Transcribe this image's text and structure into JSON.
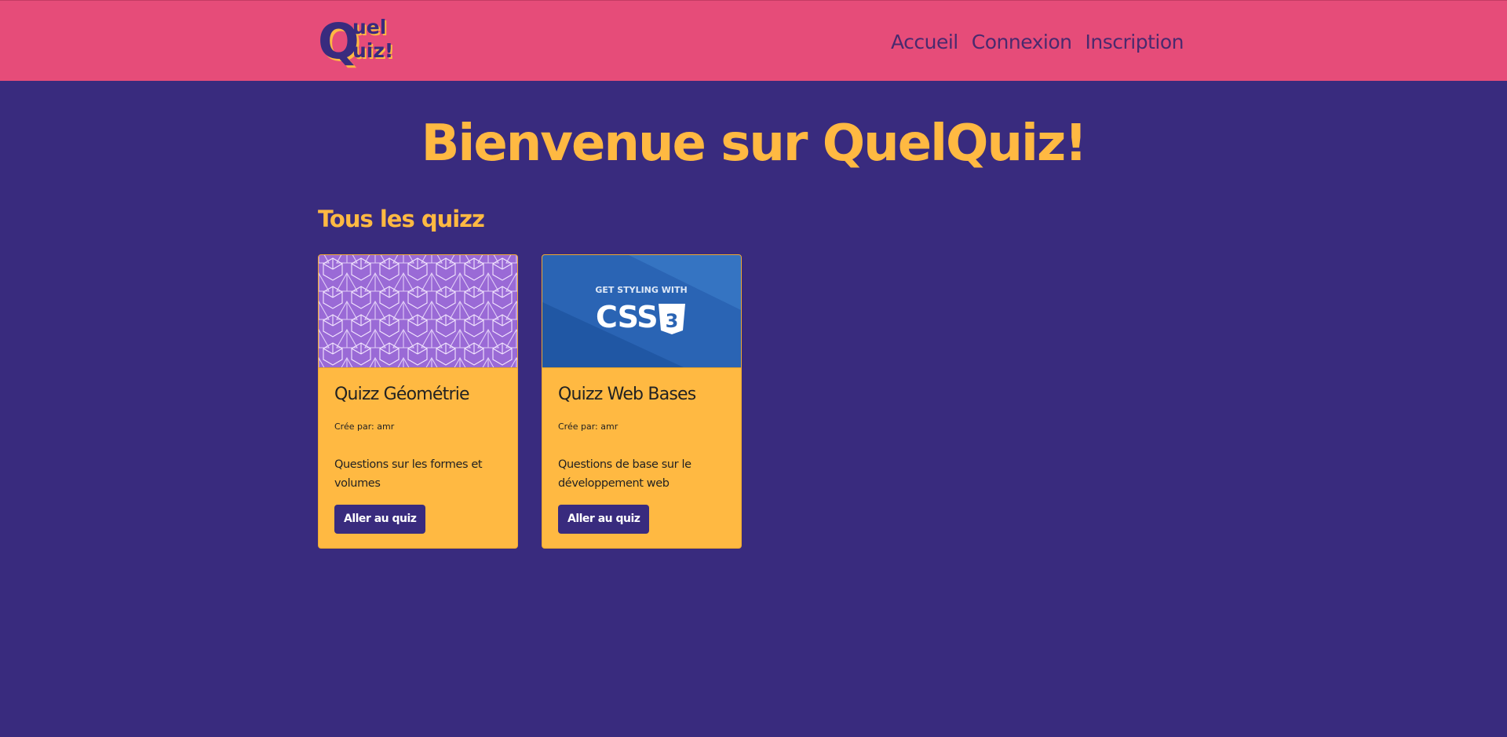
{
  "nav": {
    "logo_line1": "Quel",
    "logo_line2": "Quiz!",
    "links": [
      {
        "label": "Accueil"
      },
      {
        "label": "Connexion"
      },
      {
        "label": "Inscription"
      }
    ]
  },
  "main": {
    "title": "Bienvenue sur QuelQuiz!",
    "section_title": "Tous les quizz",
    "quizzes": [
      {
        "title": "Quizz Géométrie",
        "author": "Crée par: amr",
        "description": "Questions sur les formes et volumes",
        "button": "Aller au quiz",
        "image_icon": "geometry-pattern-image"
      },
      {
        "title": "Quizz Web Bases",
        "author": "Crée par: amr",
        "description": "Questions de base sur le développement web",
        "button": "Aller au quiz",
        "image_icon": "css-banner-image",
        "image_tagline": "GET STYLING WITH",
        "image_word": "CSS",
        "image_badge": "3"
      }
    ]
  },
  "colors": {
    "background": "#392b7e",
    "navbar": "#e64c79",
    "accent": "#ffb942",
    "button": "#392b7e"
  }
}
